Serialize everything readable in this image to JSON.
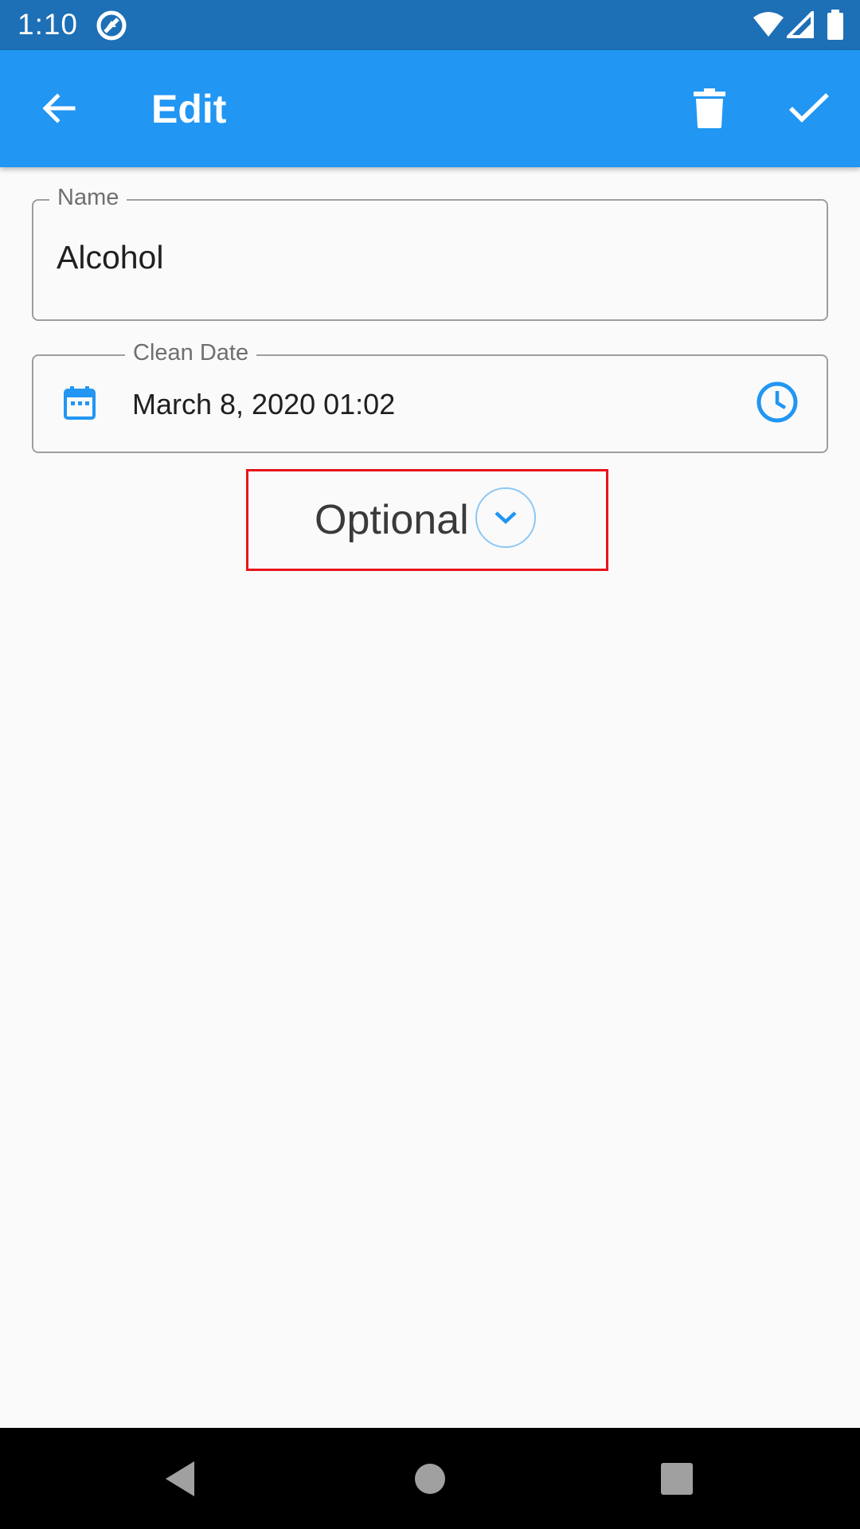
{
  "status_bar": {
    "time": "1:10",
    "icons": [
      "vpn-icon",
      "wifi-icon",
      "signal-icon",
      "battery-icon"
    ]
  },
  "app_bar": {
    "title": "Edit",
    "back_icon": "arrow-left-icon",
    "delete_icon": "trash-icon",
    "save_icon": "check-icon"
  },
  "form": {
    "name": {
      "label": "Name",
      "value": "Alcohol"
    },
    "clean_date": {
      "label": "Clean Date",
      "value": "March 8, 2020 01:02",
      "leading_icon": "calendar-icon",
      "trailing_icon": "clock-icon"
    },
    "optional": {
      "label": "Optional",
      "icon": "chevron-down-icon"
    }
  },
  "nav_bar": {
    "buttons": [
      "back-triangle-icon",
      "home-circle-icon",
      "recents-square-icon"
    ]
  },
  "colors": {
    "primary": "#2196f3",
    "status_bar": "#1d6fb6",
    "highlight_box": "#e8141a",
    "background": "#fafafa"
  }
}
